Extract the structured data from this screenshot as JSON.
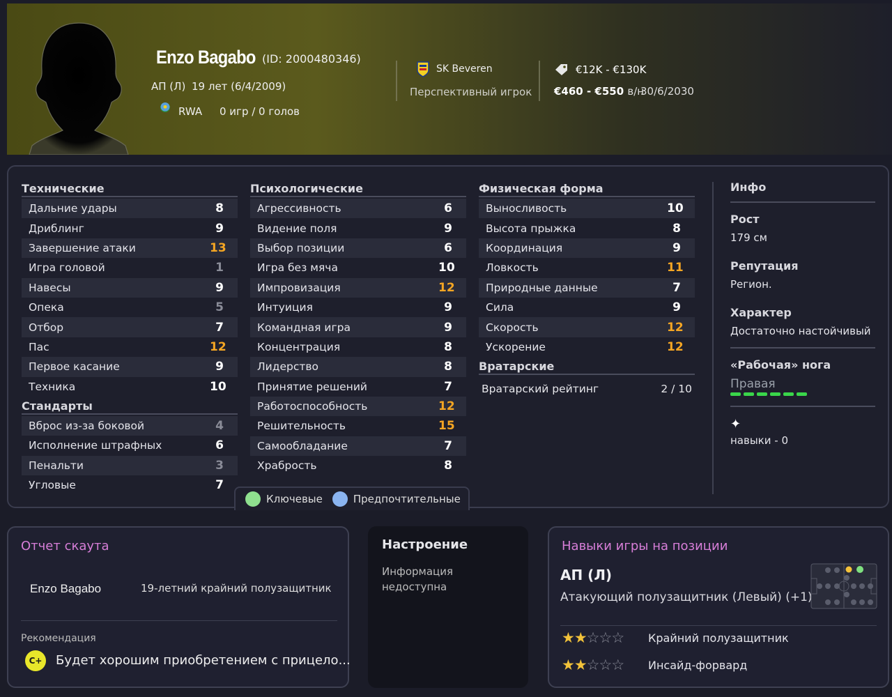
{
  "header": {
    "name": "Enzo Bagabo",
    "id": "(ID: 2000480346)",
    "position": "АП (Л)",
    "age": "19 лет (6/4/2009)",
    "nationality": "RWA",
    "games": "0 игр / 0 голов",
    "club": "SK Beveren",
    "status": "Перспективный игрок",
    "value": "€12K - €130K",
    "wage": "€460 - €550",
    "wage_unit": "в/н",
    "contract": "30/6/2030"
  },
  "technical": {
    "title": "Технические",
    "rows": [
      {
        "label": "Дальние удары",
        "value": "8",
        "tone": "n"
      },
      {
        "label": "Дриблинг",
        "value": "9",
        "tone": "n"
      },
      {
        "label": "Завершение атаки",
        "value": "13",
        "tone": "hi"
      },
      {
        "label": "Игра головой",
        "value": "1",
        "tone": "lo"
      },
      {
        "label": "Навесы",
        "value": "9",
        "tone": "n"
      },
      {
        "label": "Опека",
        "value": "5",
        "tone": "lo"
      },
      {
        "label": "Отбор",
        "value": "7",
        "tone": "n"
      },
      {
        "label": "Пас",
        "value": "12",
        "tone": "hi"
      },
      {
        "label": "Первое касание",
        "value": "9",
        "tone": "n"
      },
      {
        "label": "Техника",
        "value": "10",
        "tone": "n"
      }
    ]
  },
  "setpieces": {
    "title": "Стандарты",
    "rows": [
      {
        "label": "Вброс из-за боковой",
        "value": "4",
        "tone": "lo"
      },
      {
        "label": "Исполнение штрафных",
        "value": "6",
        "tone": "n"
      },
      {
        "label": "Пенальти",
        "value": "3",
        "tone": "lo"
      },
      {
        "label": "Угловые",
        "value": "7",
        "tone": "n"
      }
    ]
  },
  "mental": {
    "title": "Психологические",
    "rows": [
      {
        "label": "Агрессивность",
        "value": "6",
        "tone": "n"
      },
      {
        "label": "Видение поля",
        "value": "9",
        "tone": "n"
      },
      {
        "label": "Выбор позиции",
        "value": "6",
        "tone": "n"
      },
      {
        "label": "Игра без мяча",
        "value": "10",
        "tone": "n"
      },
      {
        "label": "Импровизация",
        "value": "12",
        "tone": "hi"
      },
      {
        "label": "Интуиция",
        "value": "9",
        "tone": "n"
      },
      {
        "label": "Командная игра",
        "value": "9",
        "tone": "n"
      },
      {
        "label": "Концентрация",
        "value": "8",
        "tone": "n"
      },
      {
        "label": "Лидерство",
        "value": "8",
        "tone": "n"
      },
      {
        "label": "Принятие решений",
        "value": "7",
        "tone": "n"
      },
      {
        "label": "Работоспособность",
        "value": "12",
        "tone": "hi"
      },
      {
        "label": "Решительность",
        "value": "15",
        "tone": "hi"
      },
      {
        "label": "Самообладание",
        "value": "7",
        "tone": "n"
      },
      {
        "label": "Храбрость",
        "value": "8",
        "tone": "n"
      }
    ]
  },
  "physical": {
    "title": "Физическая форма",
    "rows": [
      {
        "label": "Выносливость",
        "value": "10",
        "tone": "n"
      },
      {
        "label": "Высота прыжка",
        "value": "8",
        "tone": "n"
      },
      {
        "label": "Координация",
        "value": "9",
        "tone": "n"
      },
      {
        "label": "Ловкость",
        "value": "11",
        "tone": "hi"
      },
      {
        "label": "Природные данные",
        "value": "7",
        "tone": "n"
      },
      {
        "label": "Сила",
        "value": "9",
        "tone": "n"
      },
      {
        "label": "Скорость",
        "value": "12",
        "tone": "hi"
      },
      {
        "label": "Ускорение",
        "value": "12",
        "tone": "hi"
      }
    ]
  },
  "goalkeeping": {
    "title": "Вратарские",
    "label": "Вратарский рейтинг",
    "value": "2 / 10"
  },
  "info": {
    "title": "Инфо",
    "height_label": "Рост",
    "height": "179 см",
    "reputation_label": "Репутация",
    "reputation": "Регион.",
    "character_label": "Характер",
    "character": "Достаточно настойчивый",
    "foot_label": "«Рабочая» нога",
    "foot": "Правая",
    "foot_level": 1.0,
    "skills": "навыки - 0"
  },
  "legend": {
    "key": "Ключевые",
    "preferred": "Предпочтительные",
    "key_color": "#8fe08f",
    "preferred_color": "#8ab4f0"
  },
  "scout": {
    "title": "Отчет скаута",
    "name": "Enzo Bagabo",
    "desc": "19-летний крайний полузащитник",
    "rec_label": "Рекомендация",
    "grade": "C+",
    "rec_text": "Будет хорошим приобретением с прицело..."
  },
  "mood": {
    "title": "Настроение",
    "text": "Информация недоступна"
  },
  "positions": {
    "title": "Навыки игры на позиции",
    "code": "АП (Л)",
    "name": "Атакующий полузащитник (Левый) (+1)",
    "roles": [
      {
        "label": "Крайний полузащитник",
        "stars": 2
      },
      {
        "label": "Инсайд-форвард",
        "stars": 2
      }
    ]
  },
  "colors": {
    "highlight": "#f5a623",
    "low": "#8a8c98",
    "accent_pink": "#d77ed8",
    "grade_yellow": "#e8e62a"
  }
}
